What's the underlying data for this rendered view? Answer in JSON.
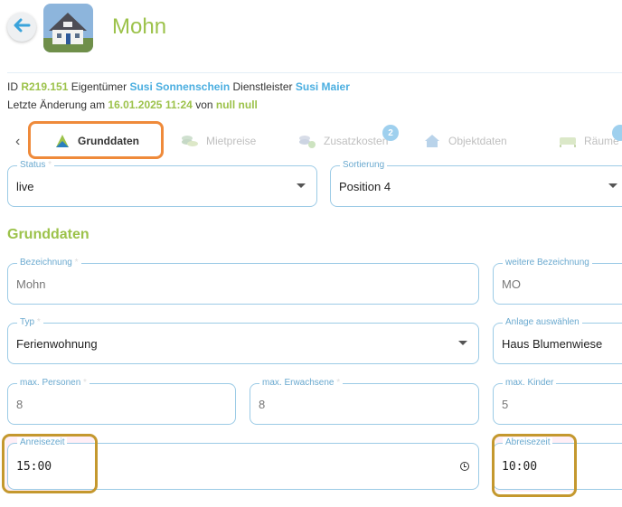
{
  "header": {
    "title": "Mohn"
  },
  "meta": {
    "id_label": "ID",
    "id_value": "R219.151",
    "owner_label": "Eigentümer",
    "owner_value": "Susi Sonnenschein",
    "provider_label": "Dienstleister",
    "provider_value": "Susi Maier",
    "changed_label": "Letzte Änderung am",
    "changed_value": "16.01.2025 11:24",
    "by_label": "von",
    "by_value": "null null"
  },
  "tabs": [
    {
      "label": "Grunddaten",
      "icon": "grunddaten-icon",
      "active": true
    },
    {
      "label": "Mietpreise",
      "icon": "coins-icon",
      "active": false
    },
    {
      "label": "Zusatzkosten",
      "icon": "coins-plus-icon",
      "badge": "2",
      "active": false
    },
    {
      "label": "Objektdaten",
      "icon": "house-icon",
      "active": false
    },
    {
      "label": "Räume",
      "icon": "bed-icon",
      "active": false
    }
  ],
  "status": {
    "label": "Status",
    "value": "live"
  },
  "sorting": {
    "label": "Sortierung",
    "value": "Position 4"
  },
  "section_title": "Grunddaten",
  "fields": {
    "bezeichnung": {
      "label": "Bezeichnung",
      "value": "Mohn"
    },
    "weitere": {
      "label": "weitere Bezeichnung",
      "value": "MO"
    },
    "typ": {
      "label": "Typ",
      "value": "Ferienwohnung"
    },
    "anlage": {
      "label": "Anlage auswählen",
      "value": "Haus Blumenwiese"
    },
    "personen": {
      "label": "max. Personen",
      "value": "8"
    },
    "erwachsene": {
      "label": "max. Erwachsene",
      "value": "8"
    },
    "kinder": {
      "label": "max. Kinder",
      "value": "5"
    },
    "anreise": {
      "label": "Anreisezeit",
      "value": "15:00"
    },
    "abreise": {
      "label": "Abreisezeit",
      "value": "10:00"
    }
  },
  "required_mark": "*",
  "colors": {
    "accent_green": "#9cc24a",
    "accent_blue": "#4aaee0",
    "highlight_orange": "#ef8a3a",
    "highlight_gold": "#c4982e"
  }
}
